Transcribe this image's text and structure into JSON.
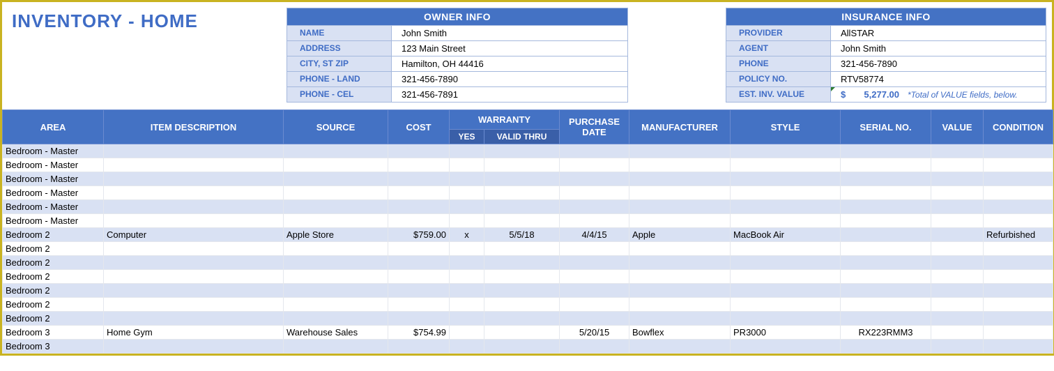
{
  "title": "INVENTORY - HOME",
  "owner": {
    "header": "OWNER INFO",
    "rows": [
      {
        "label": "NAME",
        "value": "John Smith"
      },
      {
        "label": "ADDRESS",
        "value": "123 Main Street"
      },
      {
        "label": "CITY, ST  ZIP",
        "value": "Hamilton, OH  44416"
      },
      {
        "label": "PHONE - LAND",
        "value": "321-456-7890"
      },
      {
        "label": "PHONE - CEL",
        "value": "321-456-7891"
      }
    ]
  },
  "insurance": {
    "header": "INSURANCE INFO",
    "rows": [
      {
        "label": "PROVIDER",
        "value": "AllSTAR"
      },
      {
        "label": "AGENT",
        "value": "John Smith"
      },
      {
        "label": "PHONE",
        "value": "321-456-7890"
      },
      {
        "label": "POLICY NO.",
        "value": "RTV58774"
      }
    ],
    "est_label": "EST. INV. VALUE",
    "est_currency": "$",
    "est_value": "5,277.00",
    "est_note": "*Total of VALUE fields, below."
  },
  "columns": {
    "area": "AREA",
    "desc": "ITEM DESCRIPTION",
    "source": "SOURCE",
    "cost": "COST",
    "warranty": "WARRANTY",
    "yes": "YES",
    "valid": "VALID THRU",
    "pdate": "PURCHASE DATE",
    "mfr": "MANUFACTURER",
    "style": "STYLE",
    "serial": "SERIAL NO.",
    "value": "VALUE",
    "cond": "CONDITION"
  },
  "rows": [
    {
      "area": "Bedroom - Master"
    },
    {
      "area": "Bedroom - Master"
    },
    {
      "area": "Bedroom - Master"
    },
    {
      "area": "Bedroom - Master"
    },
    {
      "area": "Bedroom - Master"
    },
    {
      "area": "Bedroom - Master"
    },
    {
      "area": "Bedroom 2",
      "desc": "Computer",
      "source": "Apple Store",
      "cost": "$759.00",
      "yes": "x",
      "valid": "5/5/18",
      "pdate": "4/4/15",
      "mfr": "Apple",
      "style": "MacBook Air",
      "serial": "",
      "value": "",
      "cond": "Refurbished"
    },
    {
      "area": "Bedroom 2"
    },
    {
      "area": "Bedroom 2"
    },
    {
      "area": "Bedroom 2"
    },
    {
      "area": "Bedroom 2"
    },
    {
      "area": "Bedroom 2"
    },
    {
      "area": "Bedroom 2"
    },
    {
      "area": "Bedroom 3",
      "desc": "Home Gym",
      "source": "Warehouse Sales",
      "cost": "$754.99",
      "yes": "",
      "valid": "",
      "pdate": "5/20/15",
      "mfr": "Bowflex",
      "style": "PR3000",
      "serial": "RX223RMM3",
      "value": "",
      "cond": ""
    },
    {
      "area": "Bedroom 3"
    }
  ]
}
